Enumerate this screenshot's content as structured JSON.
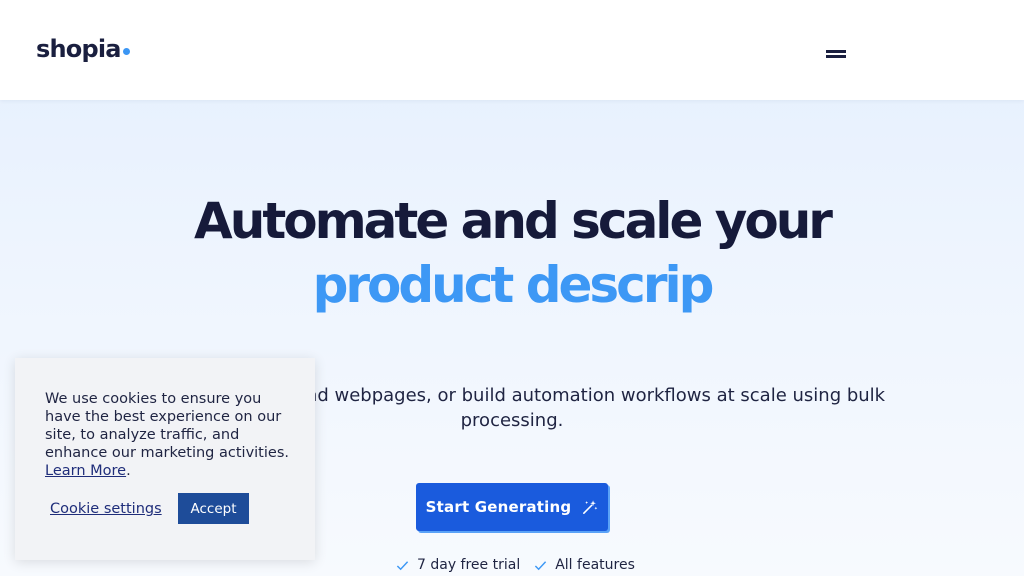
{
  "header": {
    "logo_text": "shopia",
    "menu_icon": "hamburger-menu-icon"
  },
  "hero": {
    "line1": "Automate and scale your",
    "line2": "product descrip",
    "subtitle": "nt, research files and webpages, or build automation workflows at scale using bulk processing.",
    "cta_label": "Start Generating",
    "cta_icon": "magic-wand-icon",
    "features": [
      {
        "label": "7 day free trial",
        "icon": "check-icon"
      },
      {
        "label": "All features",
        "icon": "check-icon"
      }
    ]
  },
  "cookie_banner": {
    "message": "We use cookies to ensure you have the best experience on our site, to analyze traffic, and enhance our marketing activities.",
    "learn_more": "Learn More",
    "period": ".",
    "settings_label": "Cookie settings",
    "accept_label": "Accept"
  },
  "colors": {
    "brand_dark": "#1a1f3f",
    "brand_blue": "#3d98f5",
    "cta_blue": "#1a5bdd",
    "accept_blue": "#1e4c99"
  }
}
